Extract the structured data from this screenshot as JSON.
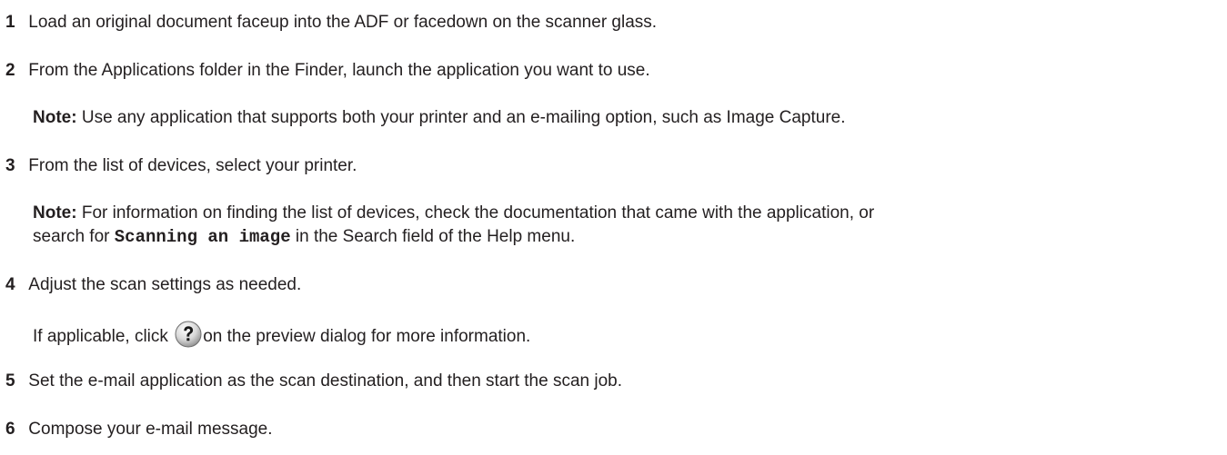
{
  "steps": [
    {
      "num": "1",
      "text": "Load an original document faceup into the ADF or facedown on the scanner glass."
    },
    {
      "num": "2",
      "text": "From the Applications folder in the Finder, launch the application you want to use."
    },
    {
      "num": "3",
      "text": "From the list of devices, select your printer."
    },
    {
      "num": "4",
      "text": "Adjust the scan settings as needed."
    },
    {
      "num": "5",
      "text": "Set the e-mail application as the scan destination, and then start the scan job."
    },
    {
      "num": "6",
      "text": "Compose your e-mail message."
    }
  ],
  "note1": {
    "label": "Note:",
    "text": " Use any application that supports both your printer and an e-mailing option, such as Image Capture."
  },
  "note2": {
    "label": "Note:",
    "line1": " For information on finding the list of devices, check the documentation that came with the application, or",
    "line2_pre": "search for ",
    "line2_code": "Scanning an image",
    "line2_post": " in the Search field of the Help menu."
  },
  "step4_detail": {
    "pre": "If applicable, click ",
    "post": "on the preview dialog for more information."
  },
  "icons": {
    "help": "help-question-icon"
  }
}
